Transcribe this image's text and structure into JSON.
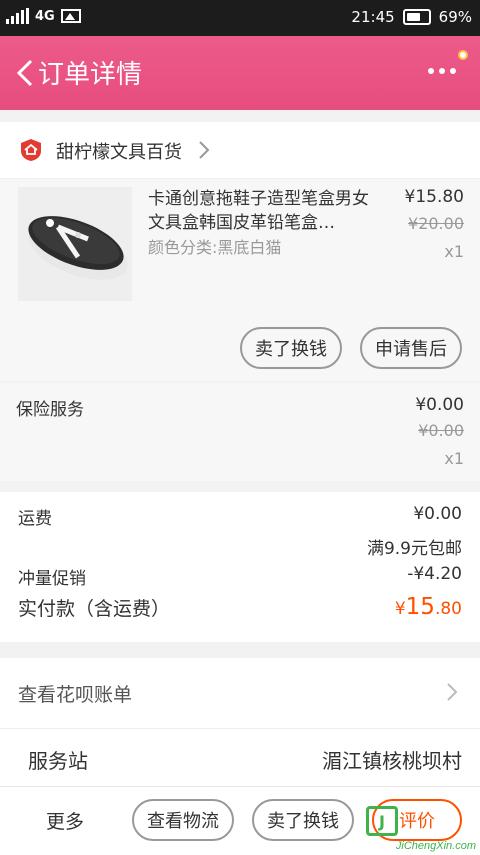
{
  "statusbar": {
    "network": "4G",
    "time": "21:45",
    "battery_pct": "69%",
    "battery_level": 0.69
  },
  "appbar": {
    "title": "订单详情"
  },
  "shop": {
    "name": "甜柠檬文具百货"
  },
  "item": {
    "title": "卡通创意拖鞋子造型笔盒男女文具盒韩国皮革铅笔盒…",
    "variant": "颜色分类:黑底白猫",
    "price": "¥15.80",
    "original_price": "¥20.00",
    "quantity": "x1",
    "actions": [
      "卖了换钱",
      "申请售后"
    ]
  },
  "insurance": {
    "label": "保险服务",
    "price": "¥0.00",
    "original_price": "¥0.00",
    "quantity": "x1"
  },
  "summary": {
    "shipping_label": "运费",
    "shipping_value": "¥0.00",
    "shipping_note": "满9.9元包邮",
    "promo_label": "冲量促销",
    "promo_value": "-¥4.20",
    "total_label": "实付款（含运费）",
    "total_currency": "¥",
    "total_int": "15",
    "total_dec": ".80"
  },
  "huabei": {
    "label": "查看花呗账单"
  },
  "station": {
    "label": "服务站",
    "value": "湄江镇核桃坝村"
  },
  "bottombar": {
    "more": "更多",
    "logistics": "查看物流",
    "resell": "卖了换钱",
    "rate": "评价"
  },
  "watermark": {
    "brand": "JiChengXin.com"
  },
  "colors": {
    "accent": "#e94f81",
    "price_orange": "#ff5000"
  }
}
